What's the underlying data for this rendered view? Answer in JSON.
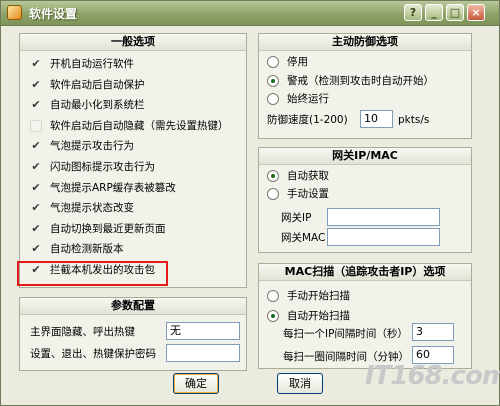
{
  "window": {
    "title": "软件设置",
    "caption_buttons": [
      "?",
      "_",
      "□",
      "×"
    ]
  },
  "general": {
    "header": "一般选项",
    "options": [
      {
        "label": "开机自动运行软件",
        "checked": true
      },
      {
        "label": "软件启动后自动保护",
        "checked": true
      },
      {
        "label": "自动最小化到系统栏",
        "checked": true
      },
      {
        "label": "软件启动后自动隐藏（需先设置热键）",
        "checked": false
      },
      {
        "label": "气泡提示攻击行为",
        "checked": true
      },
      {
        "label": "闪动图标提示攻击行为",
        "checked": true
      },
      {
        "label": "气泡提示ARP缓存表被篡改",
        "checked": true
      },
      {
        "label": "气泡提示状态改变",
        "checked": true
      },
      {
        "label": "自动切换到最近更新页面",
        "checked": true
      },
      {
        "label": "自动检测新版本",
        "checked": true
      },
      {
        "label": "拦截本机发出的攻击包",
        "checked": true
      }
    ]
  },
  "params": {
    "header": "参数配置",
    "hotkey_label": "主界面隐藏、呼出热键",
    "hotkey_value": "无",
    "password_label": "设置、退出、热键保护密码",
    "password_value": ""
  },
  "defense": {
    "header": "主动防御选项",
    "options": [
      {
        "label": "停用",
        "selected": false
      },
      {
        "label": "警戒（检测到攻击时自动开始）",
        "selected": true
      },
      {
        "label": "始终运行",
        "selected": false
      }
    ],
    "speed_label": "防御速度(1-200)",
    "speed_value": "10",
    "speed_unit": "pkts/s"
  },
  "gateway": {
    "header": "网关IP/MAC",
    "options": [
      {
        "label": "自动获取",
        "selected": true
      },
      {
        "label": "手动设置",
        "selected": false
      }
    ],
    "ip_label": "网关IP",
    "ip_value": "",
    "mac_label": "网关MAC",
    "mac_value": ""
  },
  "macscan": {
    "header": "MAC扫描（追踪攻击者IP）选项",
    "options": [
      {
        "label": "手动开始扫描",
        "selected": false
      },
      {
        "label": "自动开始扫描",
        "selected": true
      }
    ],
    "ip_interval_label": "每扫一个IP间隔时间（秒）",
    "ip_interval_value": "3",
    "round_interval_label": "每扫一圈间隔时间（分钟）",
    "round_interval_value": "60"
  },
  "buttons": {
    "ok": "确定",
    "cancel": "取消"
  },
  "watermark": "IT168.com",
  "colors": {
    "highlight_border": "#e41b1b",
    "title_bar": "#8ea268",
    "dialog_bg": "#ecebe0"
  }
}
